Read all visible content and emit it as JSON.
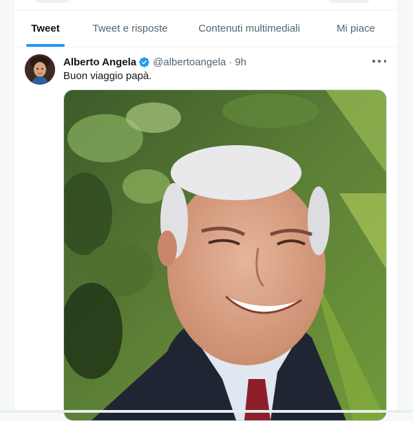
{
  "tabs": [
    {
      "label": "Tweet",
      "active": true
    },
    {
      "label": "Tweet e risposte",
      "active": false
    },
    {
      "label": "Contenuti multimediali",
      "active": false
    },
    {
      "label": "Mi piace",
      "active": false
    }
  ],
  "tweet": {
    "author_name": "Alberto Angela",
    "verified": true,
    "handle": "@albertoangela",
    "separator": "·",
    "time": "9h",
    "text": "Buon viaggio papà.",
    "more_icon": "more-horizontal-icon",
    "media_description_icon": "photo"
  },
  "colors": {
    "accent": "#1d9bf0",
    "text_primary": "#0f1419",
    "text_secondary": "#536471",
    "border": "#eff3f4"
  }
}
